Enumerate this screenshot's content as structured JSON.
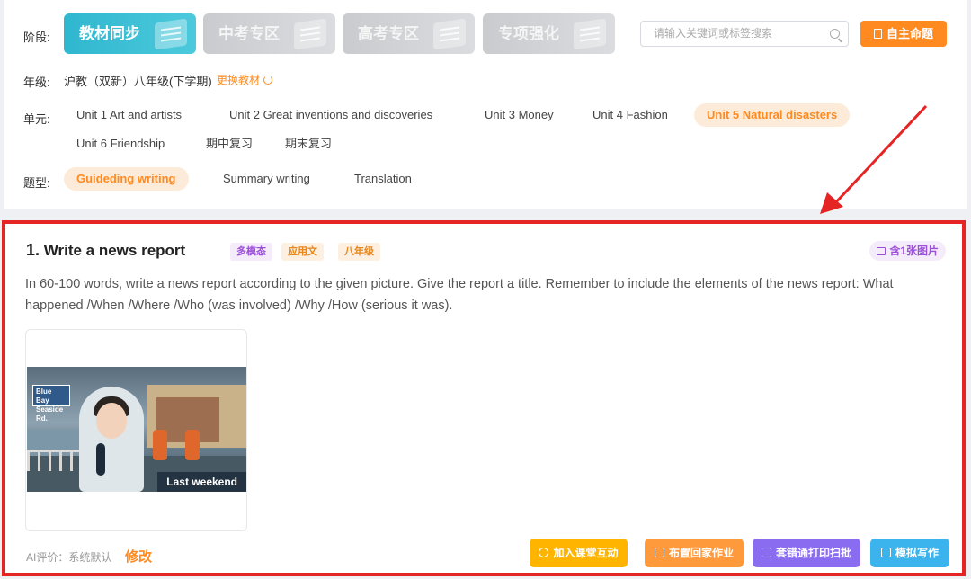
{
  "filters": {
    "stage_label": "阶段:",
    "stage_tabs": [
      {
        "label": "教材同步"
      },
      {
        "label": "中考专区"
      },
      {
        "label": "高考专区"
      },
      {
        "label": "专项强化"
      }
    ],
    "search_placeholder": "请输入关键词或标签搜索",
    "custom_button": "自主命题",
    "grade_label": "年级:",
    "grade_value": "沪教（双新）八年级(下学期)",
    "change_textbook": "更换教材",
    "unit_label": "单元:",
    "units": [
      "Unit 1 Art and artists",
      "Unit 2 Great inventions and discoveries",
      "Unit 3 Money",
      "Unit 4 Fashion",
      "Unit 5 Natural disasters",
      "Unit 6 Friendship",
      "期中复习",
      "期末复习"
    ],
    "type_label": "题型:",
    "question_types": [
      "Guideding writing",
      "Summary writing",
      "Translation"
    ]
  },
  "question": {
    "number": "1.",
    "title": "Write a news report",
    "tags": [
      "多模态",
      "应用文",
      "八年级"
    ],
    "image_badge": "含1张图片",
    "body": "In 60-100 words, write a news report according to the given picture. Give the report a title. Remember to include the elements of the news report: What happened /When /Where /Who (was involved) /Why /How (serious it was).",
    "image_sign_line1": "Blue Bay",
    "image_sign_line2": "Seaside Rd.",
    "image_caption": "Last weekend",
    "ai_eval_label": "AI评价：系统默认",
    "ai_edit": "修改",
    "actions": [
      "加入课堂互动",
      "布置回家作业",
      "套错通打印扫批",
      "模拟写作"
    ]
  },
  "colors": {
    "accent_orange": "#ff8a1f",
    "active_tab": "#2fb7cf",
    "highlight_border": "#e52424",
    "btn_yellow": "#ffb400",
    "btn_orange": "#ff9a3c",
    "btn_purple": "#8a6cf0",
    "btn_blue": "#3bb4ee"
  },
  "icons": [
    "book-icon",
    "search-icon",
    "document-icon",
    "refresh-icon",
    "image-icon",
    "play-circle-icon",
    "homework-icon",
    "scan-icon",
    "pen-icon",
    "red-arrow"
  ]
}
